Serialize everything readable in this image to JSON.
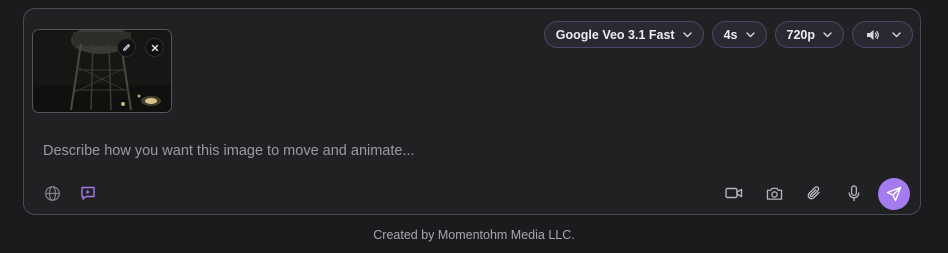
{
  "composer": {
    "prompt_placeholder": "Describe how you want this image to move and animate...",
    "attachment": {
      "edit_icon": "pencil-icon",
      "remove_icon": "close-icon"
    },
    "settings": {
      "model": "Google Veo 3.1 Fast",
      "duration": "4s",
      "resolution": "720p",
      "audio_icon": "speaker-icon"
    },
    "left_tools": [
      "globe-icon",
      "video-chat-icon"
    ],
    "right_tools": [
      "video-camera-icon",
      "camera-icon",
      "paperclip-icon",
      "microphone-icon"
    ],
    "send_icon": "send-icon"
  },
  "colors": {
    "background": "#1b1b1e",
    "accent": "#a57bf0",
    "pill_border": "#4c4766"
  },
  "footer": {
    "credit": "Created by Momentohm Media LLC."
  }
}
